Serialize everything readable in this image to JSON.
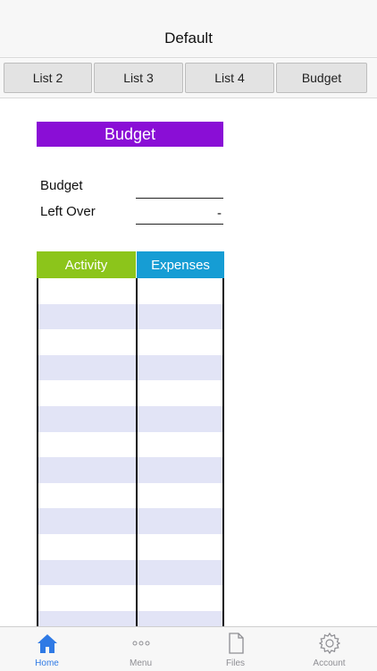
{
  "nav": {
    "title": "Default"
  },
  "tabs": [
    {
      "label": "List 2"
    },
    {
      "label": "List 3"
    },
    {
      "label": "List 4"
    },
    {
      "label": "Budget"
    }
  ],
  "budget": {
    "header": "Budget",
    "budget_label": "Budget",
    "budget_value": "",
    "leftover_label": "Left Over",
    "leftover_value": "-"
  },
  "table": {
    "columns": [
      "Activity",
      "Expenses"
    ],
    "rows": [
      [
        "",
        ""
      ],
      [
        "",
        ""
      ],
      [
        "",
        ""
      ],
      [
        "",
        ""
      ],
      [
        "",
        ""
      ],
      [
        "",
        ""
      ],
      [
        "",
        ""
      ],
      [
        "",
        ""
      ],
      [
        "",
        ""
      ],
      [
        "",
        ""
      ],
      [
        "",
        ""
      ],
      [
        "",
        ""
      ],
      [
        "",
        ""
      ],
      [
        "",
        ""
      ]
    ]
  },
  "tabbar": {
    "items": [
      {
        "label": "Home",
        "icon": "home-icon",
        "active": true
      },
      {
        "label": "Menu",
        "icon": "more-icon",
        "active": false
      },
      {
        "label": "Files",
        "icon": "file-icon",
        "active": false
      },
      {
        "label": "Account",
        "icon": "gear-icon",
        "active": false
      }
    ]
  },
  "colors": {
    "budget_header": "#8a0ed6",
    "activity_header": "#8cc51b",
    "expenses_header": "#169dd4",
    "stripe": "#e2e4f6",
    "active_tab": "#2f7ae5"
  }
}
